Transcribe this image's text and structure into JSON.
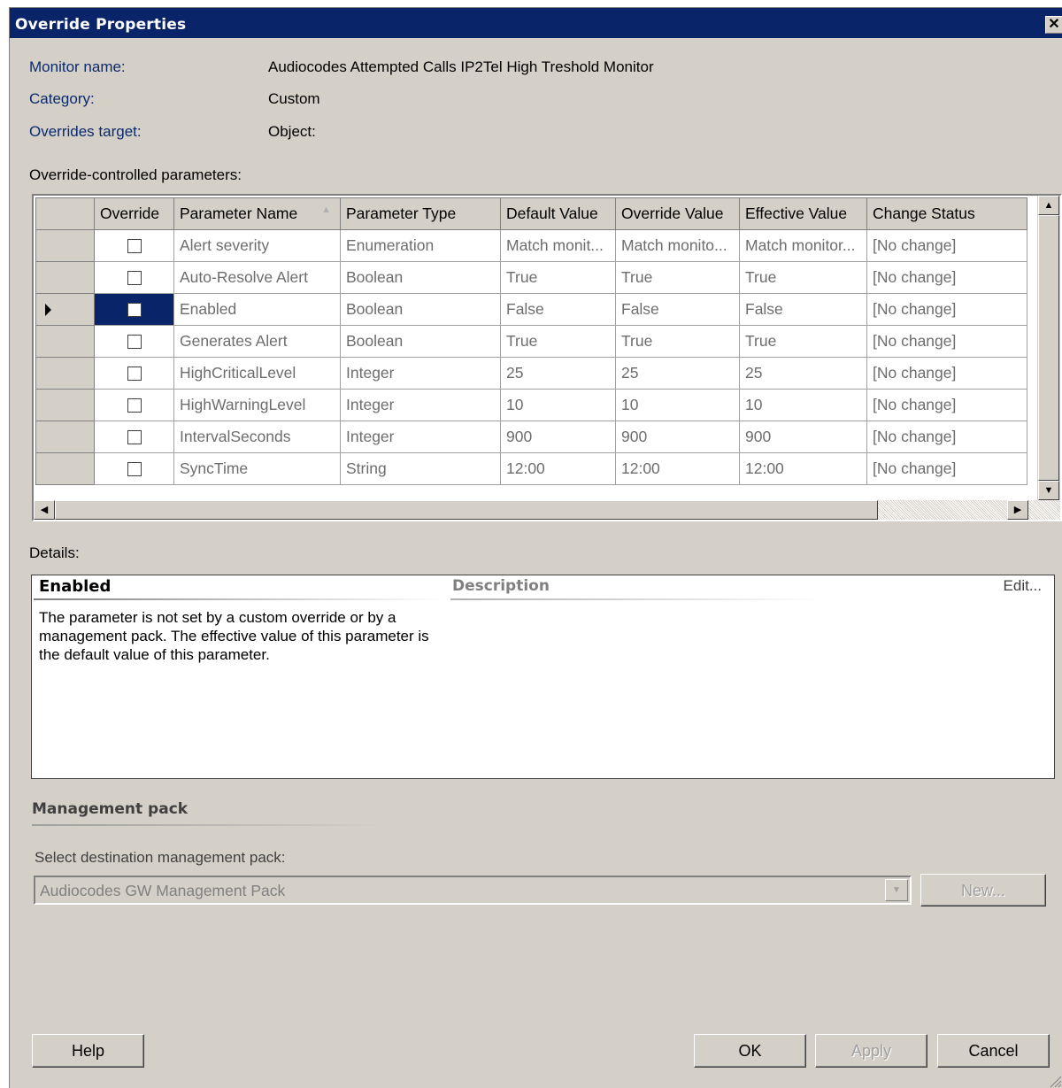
{
  "window": {
    "title": "Override Properties",
    "close_glyph": "✕"
  },
  "info": {
    "monitor_name_label": "Monitor name:",
    "monitor_name_value": "Audiocodes Attempted Calls IP2Tel High Treshold Monitor",
    "category_label": "Category:",
    "category_value": "Custom",
    "target_label": "Overrides target:",
    "target_value": "Object:"
  },
  "grid": {
    "section_label": "Override-controlled parameters:",
    "columns": [
      "Override",
      "Parameter Name",
      "Parameter Type",
      "Default Value",
      "Override Value",
      "Effective Value",
      "Change Status"
    ],
    "sort_indicator": "▲",
    "rows": [
      {
        "name": "Alert severity",
        "type": "Enumeration",
        "default": "Match monit...",
        "override": "Match monito...",
        "effective": "Match monitor...",
        "status": "[No change]",
        "checked": false,
        "selected": false
      },
      {
        "name": "Auto-Resolve Alert",
        "type": "Boolean",
        "default": "True",
        "override": "True",
        "effective": "True",
        "status": "[No change]",
        "checked": false,
        "selected": false
      },
      {
        "name": "Enabled",
        "type": "Boolean",
        "default": "False",
        "override": "False",
        "effective": "False",
        "status": "[No change]",
        "checked": false,
        "selected": true
      },
      {
        "name": "Generates Alert",
        "type": "Boolean",
        "default": "True",
        "override": "True",
        "effective": "True",
        "status": "[No change]",
        "checked": false,
        "selected": false
      },
      {
        "name": "HighCriticalLevel",
        "type": "Integer",
        "default": "25",
        "override": "25",
        "effective": "25",
        "status": "[No change]",
        "checked": false,
        "selected": false
      },
      {
        "name": "HighWarningLevel",
        "type": "Integer",
        "default": "10",
        "override": "10",
        "effective": "10",
        "status": "[No change]",
        "checked": false,
        "selected": false
      },
      {
        "name": "IntervalSeconds",
        "type": "Integer",
        "default": "900",
        "override": "900",
        "effective": "900",
        "status": "[No change]",
        "checked": false,
        "selected": false
      },
      {
        "name": "SyncTime",
        "type": "String",
        "default": "12:00",
        "override": "12:00",
        "effective": "12:00",
        "status": "[No change]",
        "checked": false,
        "selected": false
      }
    ]
  },
  "details": {
    "section_label": "Details:",
    "name": "Enabled",
    "description_heading": "Description",
    "edit_link": "Edit...",
    "text": "The parameter is not set by a custom override or by a management pack. The effective value of this parameter is the default value of this parameter."
  },
  "management_pack": {
    "heading": "Management pack",
    "select_label": "Select destination management pack:",
    "selected": "Audiocodes GW Management Pack",
    "new_button": "New..."
  },
  "buttons": {
    "help": "Help",
    "ok": "OK",
    "apply": "Apply",
    "cancel": "Cancel"
  }
}
